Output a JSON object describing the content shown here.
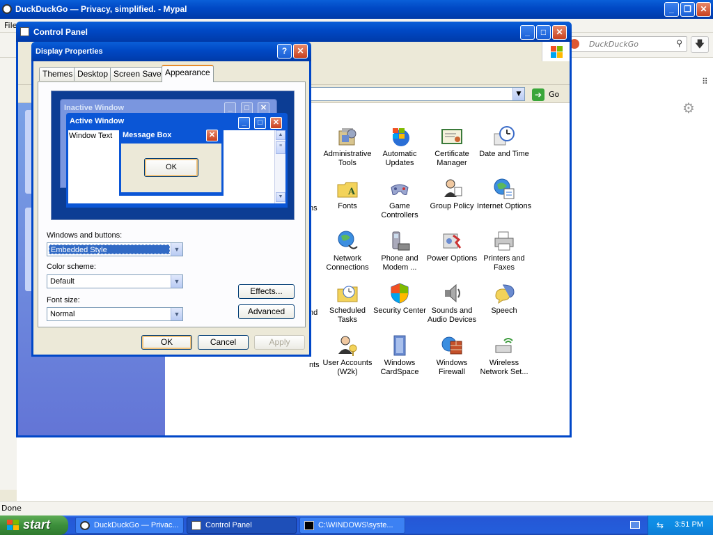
{
  "browser": {
    "title": "DuckDuckGo — Privacy, simplified. - Mypal",
    "menu_file": "File",
    "search_placeholder": "DuckDuckGo",
    "status": "Done"
  },
  "control_panel": {
    "title": "Control Panel",
    "go_label": "Go",
    "icons": [
      {
        "label": "Administrative Tools",
        "icon": "admin-tools-icon"
      },
      {
        "label": "Automatic Updates",
        "icon": "automatic-updates-icon"
      },
      {
        "label": "Certificate Manager",
        "icon": "certificate-icon"
      },
      {
        "label": "Date and Time",
        "icon": "clock-icon"
      },
      {
        "label": "Fonts",
        "icon": "fonts-folder-icon"
      },
      {
        "label": "Game Controllers",
        "icon": "gamepad-icon"
      },
      {
        "label": "Group Policy",
        "icon": "group-policy-icon"
      },
      {
        "label": "Internet Options",
        "icon": "internet-options-icon"
      },
      {
        "label": "Network Connections",
        "icon": "network-icon"
      },
      {
        "label": "Phone and Modem ...",
        "icon": "phone-icon"
      },
      {
        "label": "Power Options",
        "icon": "power-icon"
      },
      {
        "label": "Printers and Faxes",
        "icon": "printer-icon"
      },
      {
        "label": "Scheduled Tasks",
        "icon": "scheduled-tasks-icon"
      },
      {
        "label": "Security Center",
        "icon": "shield-icon"
      },
      {
        "label": "Sounds and Audio Devices",
        "icon": "speaker-icon"
      },
      {
        "label": "Speech",
        "icon": "speech-icon"
      },
      {
        "label": "User Accounts (W2k)",
        "icon": "user-accounts-icon"
      },
      {
        "label": "Windows CardSpace",
        "icon": "cardspace-icon"
      },
      {
        "label": "Windows Firewall",
        "icon": "firewall-icon"
      },
      {
        "label": "Wireless Network Set...",
        "icon": "wireless-icon"
      }
    ],
    "cut_labels": [
      "ns",
      "nd",
      "nts"
    ]
  },
  "display_properties": {
    "title": "Display Properties",
    "help_btn": "?",
    "tabs": [
      "Themes",
      "Desktop",
      "Screen Saver",
      "Appearance"
    ],
    "active_tab": "Appearance",
    "preview": {
      "inactive_title": "Inactive Window",
      "active_title": "Active Window",
      "window_text": "Window Text",
      "msgbox_title": "Message Box",
      "msgbox_ok": "OK"
    },
    "windows_buttons_label": "Windows and buttons:",
    "windows_buttons_value": "Embedded Style",
    "color_scheme_label": "Color scheme:",
    "color_scheme_value": "Default",
    "font_size_label": "Font size:",
    "font_size_value": "Normal",
    "effects_btn": "Effects...",
    "advanced_btn": "Advanced",
    "ok_btn": "OK",
    "cancel_btn": "Cancel",
    "apply_btn": "Apply"
  },
  "taskbar": {
    "start": "start",
    "items": [
      {
        "label": "DuckDuckGo — Privac..."
      },
      {
        "label": "Control Panel"
      },
      {
        "label": "C:\\WINDOWS\\syste..."
      }
    ],
    "clock": "3:51 PM"
  },
  "colors": {
    "xp_blue": "#0047c8",
    "close_red": "#c9411f",
    "start_green": "#3c8f3b",
    "selection": "#316ac5"
  }
}
